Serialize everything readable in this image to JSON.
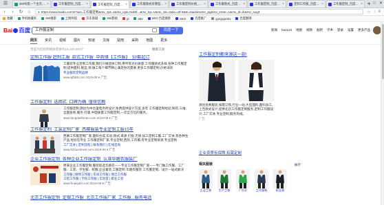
{
  "tabs": [
    {
      "title": "360导航—个主页,一个世界",
      "color": "#19a15f"
    },
    {
      "title": "工作服定制_百度搜索",
      "color": "#2932e1"
    },
    {
      "title": "工作服定制_百度搜索",
      "color": "#2932e1",
      "active": true
    },
    {
      "title": "工作服款式有哪些_百度搜索",
      "color": "#2932e1"
    },
    {
      "title": "工作服定制价格_百度搜索",
      "color": "#2932e1"
    },
    {
      "title": "工作服款式_百度搜索",
      "color": "#2932e1"
    },
    {
      "title": "工作服定制_百度搜索",
      "color": "#2932e1"
    },
    {
      "title": "定制工作服_百度搜索",
      "color": "#2932e1"
    },
    {
      "title": "工作服定制_百度搜索",
      "color": "#2932e1"
    }
  ],
  "address": {
    "url": "https://www.baidu.com/s?wd=工作服定制&rsv_spt=1&rsv_iqid=0xd5f...&rsv_bp=1&rsv_idx=2&ie=utf-8&tn=baiduhome_pg&rsv_enter=1&rsv_dl=ib&rsv_sug3"
  },
  "bookmarks": [
    "收藏",
    "手机收藏夹",
    "360搜索",
    "上网导航",
    "京东商城",
    "360影视",
    "jd",
    "360",
    "SEO 百度搜索",
    "SEO",
    "百度推广",
    "gongsju001",
    "百度翻译"
  ],
  "baidu": {
    "logo_a": "Bai",
    "logo_b": "百度",
    "query": "工作服定制",
    "search_btn": "百度一下",
    "links": [
      "新闻",
      "hao123",
      "地图",
      "视频",
      "贴吧",
      "学术",
      "登录",
      "设置",
      "更多产品"
    ]
  },
  "result_tabs": [
    "网页",
    "资讯",
    "视频",
    "图片",
    "知道",
    "文库",
    "贴吧",
    "采购",
    "地图",
    "更多"
  ],
  "stat": "百度为您找到相关结果约16,300,000个",
  "search_tool": "搜索工具",
  "results": [
    {
      "title": "定制工作服 赶制工服_款式工作服_中商储【工作服】_50套起订",
      "desc": "工服装专业定制工作服,我们只做团体订制,用平等对价质量 工作服款式多样,各种工作服定制,提供面料,版型,领,做工每个细节精心满足你的需要,更多工作服定制,价格详询",
      "brand": "专业服装定制品牌",
      "meta": "www.qfb88.com 2019-08 ▾ 广告"
    },
    {
      "title": "工作服定制_选朗式_口碑为确_值得信赖",
      "desc": "工作服定制,朗达为中台里电务所设计,免费提供设计方案,多年 工作服定制经验,制衣,三维,全国各地,服务,打版,中国质量工作服定制,一次全方位的服务。",
      "meta": "www.langdashmao.com 2019-08 ▾ 广告"
    },
    {
      "title": "工作服定制_工装定制厂家_西赛服装专业定制工服15年",
      "desc": "西赛工作服定制厂家,面料合成,实验,款式,来源 打版,无保,加工定制工服,工厂实体,有各种生产品,经验在专业 工作服定制厂家,专业定制,西装,工作服,有专业定制资源,专业定制",
      "sub": "工厂实体 | 定制流程 | 联系我们 | 在线咨询",
      "meta": "www.fizhuiaimwe.com 2019-08 ▾ 广告"
    },
    {
      "title": "企业工作服定制_各种企业工作服定制_认准华路衣服装厂",
      "desc": "原来企业工作服定制,服装就选华路衣——专业工作服定制厂家——专门做工作服、工厂服、工装、学生服、校服,企业着装,工服定制 华路衣服装 工作服定制、设计—站式解决",
      "sub": "工作服 | 厨师工作服 | 车间工作服 | 保洁工作服\n工程工作服 | 学校工作服 | 实验室 | 职业工装",
      "meta": "www.huaxjafd.com 2019-08 ▾ 广告"
    },
    {
      "title": "北京工作服定制_定做工作服_北京工作服厂家_工作服...服务电话"
    }
  ],
  "right": {
    "title": "工作服定制都来源这一款!",
    "desc": "源创优秀服装,按需订购,行业一站,大型面料,面料加工,上百款式设计,提供北京工作服定制服务,定制工作服设计,工厂实体,专业定制,服务热线。",
    "ad": "广告",
    "ad2": "企业资质有保障,有需定制",
    "related_title": "相关服装",
    "related_more": "展开",
    "related": [
      "企业工装",
      "生产工装",
      "广告衫",
      "工作服装",
      "职业装"
    ]
  },
  "colors": {
    "link": "#2440b3",
    "brand": "#4e6ef2",
    "red": "#c00",
    "green": "#008000"
  }
}
